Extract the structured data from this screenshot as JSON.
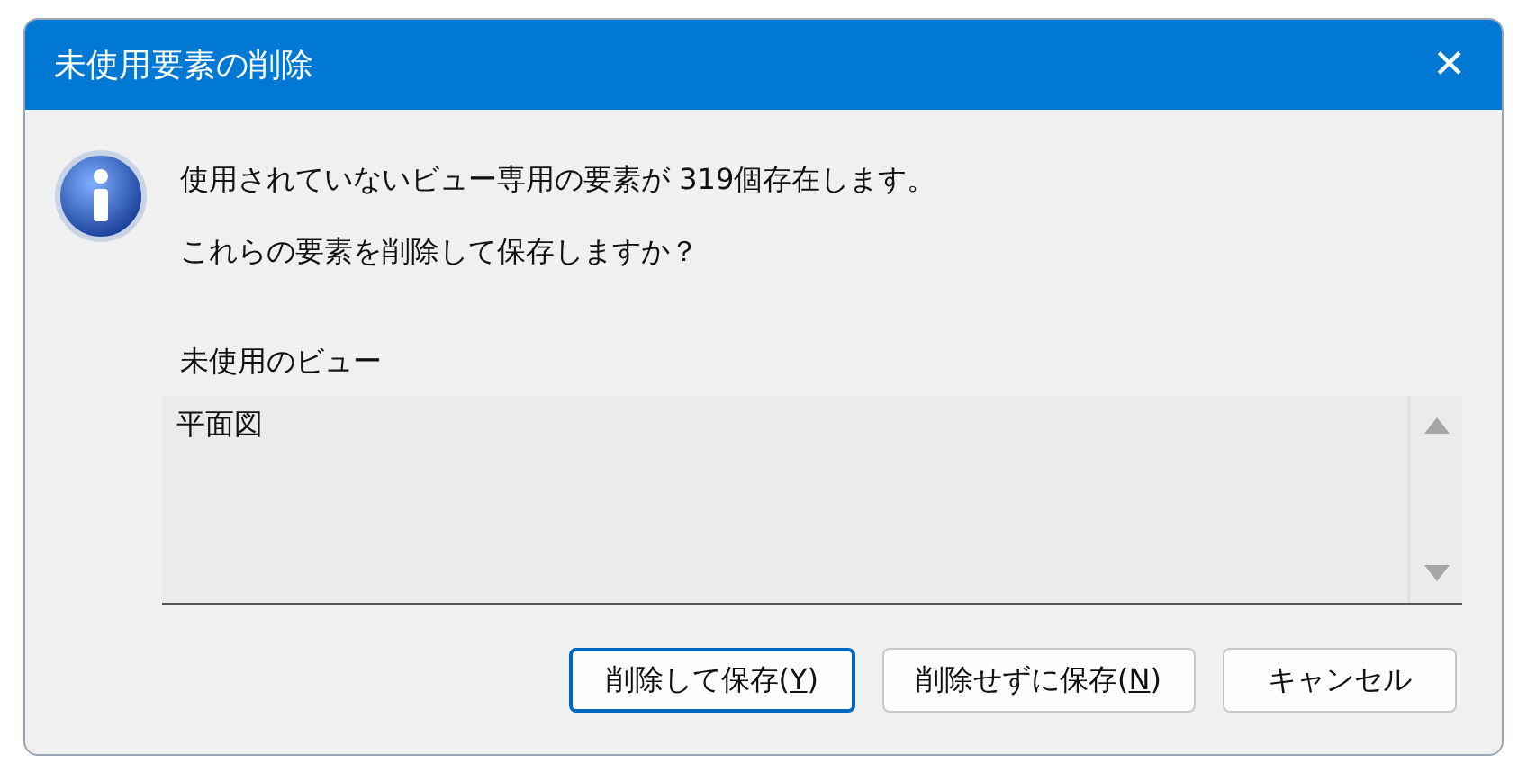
{
  "window": {
    "title": "未使用要素の削除",
    "close": "✕"
  },
  "message": {
    "lines": [
      "使用されていないビュー専用の要素が 319個存在します。",
      "これらの要素を削除して保存しますか？"
    ]
  },
  "list": {
    "label": "未使用のビュー",
    "items": [
      {
        "text": "平面図",
        "selected": false
      }
    ]
  },
  "buttons": [
    {
      "prefix": "削除して保存(",
      "key": "Y",
      "suffix": ")",
      "default": true
    },
    {
      "prefix": "削除せずに保存(",
      "key": "N",
      "suffix": ")",
      "default": false
    },
    {
      "prefix": "キャンセル",
      "default": false
    }
  ]
}
